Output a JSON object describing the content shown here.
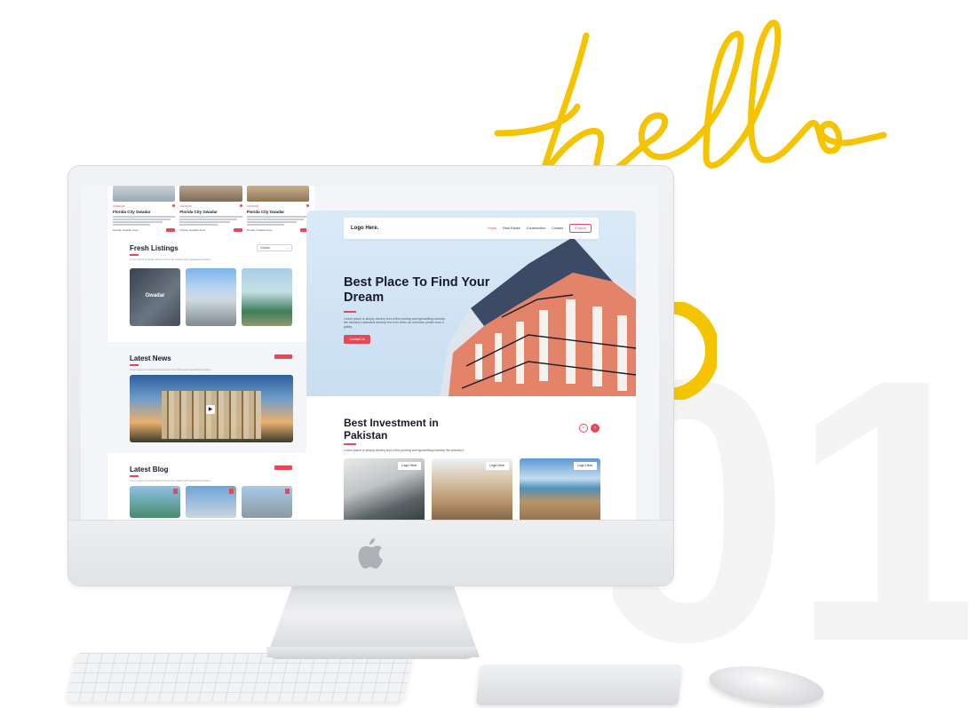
{
  "decor": {
    "hello_text": "hello",
    "big_number": "01",
    "accent_color": "#f5c400"
  },
  "left_page": {
    "property_cards": [
      {
        "tag": "GWADAR",
        "title": "Florida City Gwadar",
        "location": "Florida, Gwadar Area"
      },
      {
        "tag": "GWADAR",
        "title": "Florida City Gwadar",
        "location": "Florida, Gwadar Area"
      },
      {
        "tag": "GWADAR",
        "title": "Florida City Gwadar",
        "location": "Florida, Gwadar Area"
      }
    ],
    "fresh_listings": {
      "title": "Fresh Listings",
      "subtitle": "Lorem ipsum is simply dummy text of the printing and typesetting industry.",
      "select_value": "Gwadar",
      "items": [
        {
          "caption": "Gwadar"
        },
        {
          "caption": ""
        },
        {
          "caption": ""
        }
      ]
    },
    "latest_news": {
      "title": "Latest News",
      "subtitle": "Lorem ipsum is simply dummy text of the printing and typesetting industry."
    },
    "latest_blog": {
      "title": "Latest Blog",
      "subtitle": "Lorem ipsum is simply dummy text of the printing and typesetting industry."
    }
  },
  "right_page": {
    "nav": {
      "logo": "Logo Here.",
      "links": [
        "Home",
        "Real Estate",
        "Construction",
        "Contact"
      ],
      "enquiry": "Enquiry"
    },
    "hero": {
      "title": "Best Place To Find Your Dream",
      "description": "Lorem ipsum is simply dummy text of the printing and typesetting industry. the industry's standard dummy text ever when an unknown printer took a galley.",
      "button": "Contact Us"
    },
    "investment": {
      "title": "Best Investment in Pakistan",
      "subtitle": "Lorem ipsum is simply dummy text of the printing and typesetting industry the industry's",
      "prev": "‹",
      "next": "›",
      "cards": [
        {
          "badge": "Logo Here."
        },
        {
          "badge": "Logo Here."
        },
        {
          "badge": "Logo Here."
        }
      ]
    },
    "brand_color": "#e84855"
  }
}
